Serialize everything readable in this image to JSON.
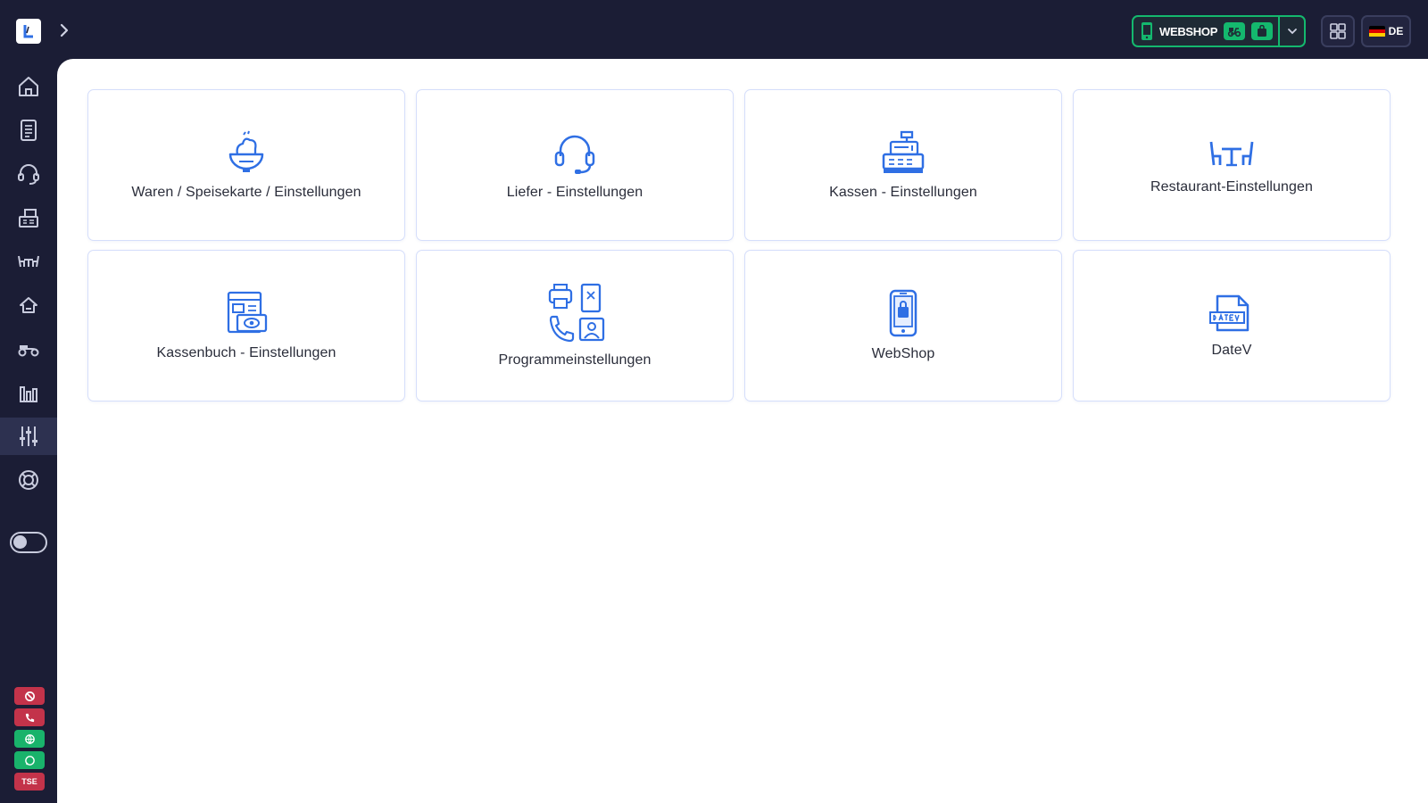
{
  "header": {
    "webshop_status": {
      "label": "WEBSHOP"
    },
    "language": {
      "code": "DE"
    }
  },
  "sidebar": {
    "items": [
      {
        "name": "sidebar-item-home",
        "icon": "home-icon"
      },
      {
        "name": "sidebar-item-documents",
        "icon": "document-icon"
      },
      {
        "name": "sidebar-item-support",
        "icon": "headset-icon"
      },
      {
        "name": "sidebar-item-cash-register",
        "icon": "cash-register-icon"
      },
      {
        "name": "sidebar-item-restaurant",
        "icon": "dining-table-icon"
      },
      {
        "name": "sidebar-item-menu",
        "icon": "food-dome-icon"
      },
      {
        "name": "sidebar-item-delivery",
        "icon": "scooter-icon"
      },
      {
        "name": "sidebar-item-statistics",
        "icon": "bar-chart-icon"
      },
      {
        "name": "sidebar-item-settings",
        "icon": "sliders-icon",
        "active": true
      },
      {
        "name": "sidebar-item-help",
        "icon": "lifebuoy-icon"
      }
    ],
    "status_chips": [
      {
        "icon": "blocked-icon",
        "color": "#c3334a"
      },
      {
        "icon": "phone-icon",
        "color": "#c3334a"
      },
      {
        "icon": "globe-icon",
        "color": "#19b36b"
      },
      {
        "icon": "chat-icon",
        "color": "#19b36b"
      },
      {
        "label": "TSE",
        "color": "#c3334a"
      }
    ]
  },
  "tiles": [
    {
      "label": "Waren / Speisekarte / Einstellungen",
      "icon": "food-bowl-icon"
    },
    {
      "label": "Liefer - Einstellungen",
      "icon": "headset-icon"
    },
    {
      "label": "Kassen - Einstellungen",
      "icon": "cash-register-icon"
    },
    {
      "label": "Restaurant-Einstellungen",
      "icon": "dining-table-icon"
    },
    {
      "label": "Kassenbuch - Einstellungen",
      "icon": "cashbook-icon"
    },
    {
      "label": "Programmeinstellungen",
      "icon": "devices-icon"
    },
    {
      "label": "WebShop",
      "icon": "mobile-shop-icon"
    },
    {
      "label": "DateV",
      "icon": "datev-file-icon"
    }
  ],
  "colors": {
    "sidebar_bg": "#1b1d35",
    "accent_blue": "#2f6fe4",
    "online_green": "#14b86e",
    "alert_red": "#c3334a"
  }
}
